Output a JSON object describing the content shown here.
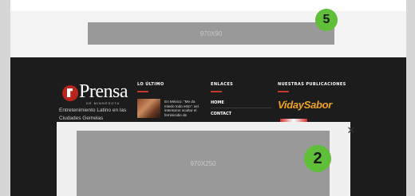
{
  "ads": {
    "top_label": "970X90",
    "bottom_label": "970X250"
  },
  "badges": {
    "top": "5",
    "bottom": "2"
  },
  "colors": {
    "badge_green": "#5fbf38",
    "footer_bg": "#1c1c1c",
    "accent_red": "#c0392b",
    "vs_orange": "#f0a422"
  },
  "footer": {
    "logo": {
      "word": "Prensa",
      "sub": "DE MINNESOTA"
    },
    "tagline": "Entretenimiento Latino en las Ciudades Gemelas",
    "columns": {
      "latest_title": "LO ÚLTIMO",
      "links_title": "ENLACES",
      "publications_title": "NUESTRAS PUBLICACIONES"
    },
    "latest_item": "En México: \"Me da miedo todo esto\": así intentaron ocultar el feminicidio de",
    "links": [
      "HOME",
      "CONTACT"
    ],
    "publication_name": "VidaySabor"
  },
  "overlay": {
    "close_icon": "close-icon"
  }
}
